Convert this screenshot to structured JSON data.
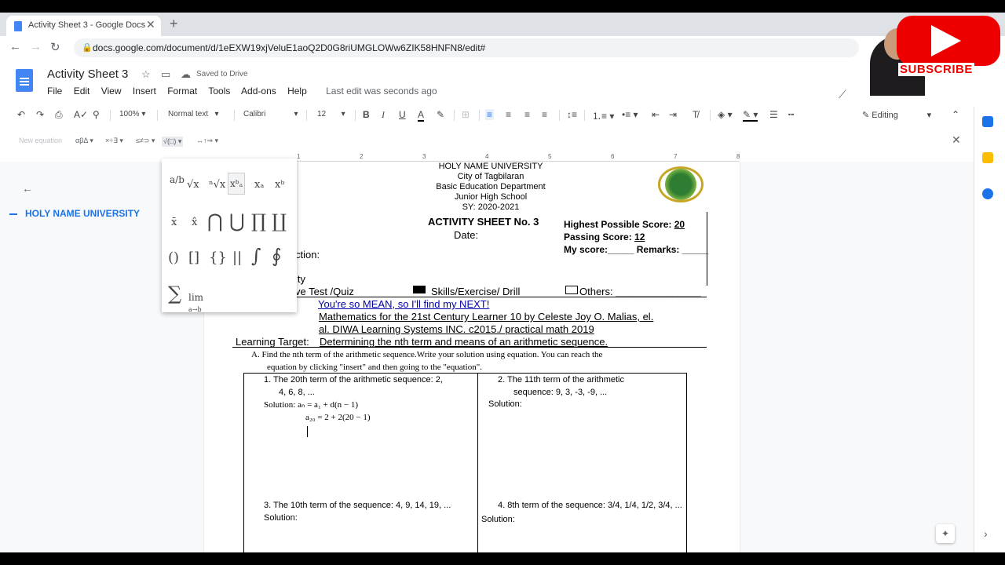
{
  "browser": {
    "tab_title": "Activity Sheet 3 - Google Docs",
    "tab_close": "✕",
    "new_tab": "+",
    "url": "docs.google.com/document/d/1eEXW19xjVeluE1aoQ2D0G8riUMGLOWw6ZIK58HNFN8/edit#"
  },
  "docs": {
    "title": "Activity Sheet 3",
    "saved_status": "Saved to Drive",
    "menu": [
      "File",
      "Edit",
      "View",
      "Insert",
      "Format",
      "Tools",
      "Add-ons",
      "Help"
    ],
    "last_edit": "Last edit was seconds ago"
  },
  "toolbar": {
    "zoom": "100%",
    "style": "Normal text",
    "font": "Calibri",
    "size": "12",
    "mode": "Editing"
  },
  "equation_bar": {
    "new_equation": "New equation",
    "greek": "αβΔ",
    "ops": "×÷∃",
    "relations": "≤≠⊃",
    "math": "√(□)",
    "arrows": "↔↑⇒"
  },
  "ruler": [
    "1",
    "2",
    "3",
    "4",
    "5",
    "6",
    "7",
    "8"
  ],
  "outline": {
    "item": "HOLY NAME UNIVERSITY"
  },
  "document": {
    "header": [
      "HOLY NAME UNIVERSITY",
      "City of Tagbilaran",
      "Basic Education Department",
      "Junior High School",
      "SY: 2020-2021"
    ],
    "sheet_title": "ACTIVITY SHEET No. 3",
    "date_label": "Date:",
    "section_label": "ction:",
    "activity_label": "ity",
    "type_quiz": "ve Test /Quiz",
    "type_skills": "Skills/Exercise/ Drill",
    "type_others": "Others: _______________",
    "score_highest_label": "Highest Possible Score: ",
    "score_highest_value": "20",
    "score_passing_label": "Passing Score: ",
    "score_passing_value": "12",
    "score_mine": "My score:_____ Remarks: _____",
    "title_line": "You're so MEAN, so I'll find my NEXT!",
    "ref_line1": "Mathematics for the 21st Century Learner 10 by Celeste Joy O. Malias, el.",
    "ref_line2": "al. DIWA Learning Systems INC. c2015./ practical math 2019",
    "target_label": "Learning Target:",
    "target_text": "Determining the nth term and means of an arithmetic sequence.",
    "instruction1": "A.  Find the nth term of the arithmetic sequence.Write your solution using equation. You can reach the",
    "instruction2": "equation by clicking \"insert\" and then going to the \"equation\".",
    "q1_line1": "1.   The 20th term of the arithmetic sequence: 2,",
    "q1_line2": "4, 6, 8, ...",
    "q1_solution": "Solution: aₙ = a₁ + d(n − 1)",
    "q1_work": "a₂₀ = 2 + 2(20 − 1)",
    "q2_line1": "2.   The 11th term of the arithmetic",
    "q2_line2": "sequence: 9, 3, -3, -9, ...",
    "q2_solution": "Solution:",
    "q3_line1": "3.   The 10th term of the sequence: 4, 9, 14, 19, ...",
    "q3_solution": "Solution:",
    "q4_line1": "4.   8th term of the sequence: 3/4, 1/4, 1/2, 3/4, ...",
    "q4_solution": "Solution:"
  },
  "palette": {
    "frac": "a/b",
    "sqrt": "√x",
    "nroot": "ⁿ√x",
    "subsup": "xᵇₐ",
    "sub": "xₐ",
    "sup": "xᵇ",
    "bar": "x̄",
    "hat": "x̂",
    "bigcap": "⋂",
    "bigcup": "⋃",
    "prod": "∏",
    "coprod": "∐",
    "paren": "()",
    "brack": "[]",
    "brace": "{}",
    "abs": "||",
    "integral": "∫",
    "oint": "∮",
    "sum": "∑",
    "lim": "lim",
    "lim_sub": "a→b",
    "lim_sub_b": "b",
    "lim_sub_a": "a"
  },
  "overlay": {
    "subscribe": "SUBSCRIBE"
  }
}
